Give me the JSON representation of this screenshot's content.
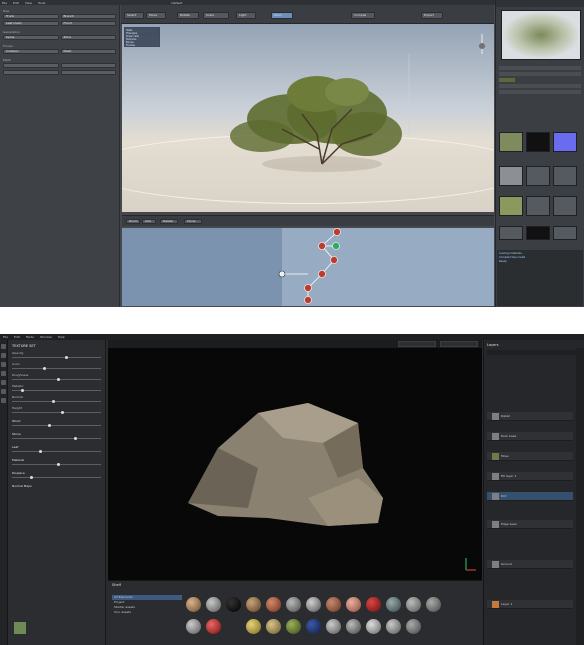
{
  "top": {
    "window_title": "Default",
    "viewport_stats": [
      "Stats",
      "Triangles",
      "Draw calls",
      "Textures",
      "Bones",
      "Frames"
    ],
    "left_panel_headings": [
      "Tree",
      "Generators",
      "Forces",
      "Mesh"
    ],
    "left_panel_buttons": [
      "Trunk",
      "Branch",
      "Leaf mesh",
      "Frond",
      "Spine",
      "Zone",
      "Collision",
      "Mesh"
    ],
    "toolbar_buttons": [
      "Select",
      "Move",
      "Rotate",
      "Scale",
      "Light",
      "Wind",
      "Compile",
      "Export"
    ],
    "graph_buttons": [
      "Zoom",
      "Add",
      "Delete",
      "Clone"
    ],
    "console_lines": [
      "Loading materials...",
      "Compiled tree model",
      "Ready"
    ]
  },
  "bottom": {
    "properties_title": "TEXTURE SET",
    "property_rows": [
      "Opacity",
      "Color",
      "Roughness",
      "Metallic",
      "Normal",
      "Height"
    ],
    "sections": [
      "Wood",
      "Stone",
      "Leaf",
      "Material",
      "Displace",
      "Normal Maps"
    ],
    "shelf_header": "Shelf",
    "shelf_categories": [
      "All Elements",
      "Project",
      "Starter assets",
      "Your assets"
    ],
    "layers_header": "Layers",
    "layers": [
      "Detail",
      "Rock base",
      "Moss",
      "Fill layer 1",
      "Dirt",
      "Edge wear",
      "Ground",
      "Layer 1"
    ]
  },
  "colors": {
    "accent": "#4a90d9",
    "foliage": "#5d6b2f",
    "rock": "#8a8170"
  }
}
